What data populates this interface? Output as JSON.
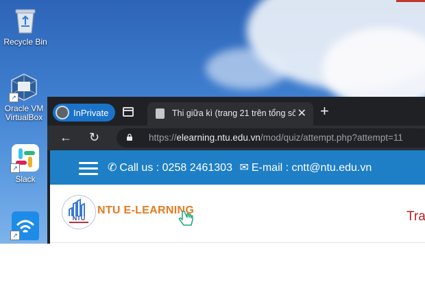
{
  "desktop": {
    "icons": [
      {
        "label": "Recycle Bin",
        "icon": "recycle-bin-icon"
      },
      {
        "label": "Oracle VM VirtualBox",
        "icon": "virtualbox-icon"
      },
      {
        "label": "Slack",
        "icon": "slack-icon"
      },
      {
        "label": "",
        "icon": "wifi-app-icon"
      }
    ]
  },
  "browser": {
    "inprivate_label": "InPrivate",
    "tab_title": "Thi giữa kì (trang 21 trên tổng số",
    "url_scheme": "https://",
    "url_host": "elearning.ntu.edu.vn",
    "url_path": "/mod/quiz/attempt.php?attempt=11",
    "new_tab_symbol": "+"
  },
  "site": {
    "phone_text": "Call us : 0258 2461303",
    "email_text": "E-mail : cntt@ntu.edu.vn",
    "logo_text": "NTU E-LEARNING",
    "logo_abbr": "NTU",
    "right_text": "Tra",
    "colors": {
      "topbar": "#1e7fc6",
      "logo_orange": "#e8791e",
      "right_text": "#b22222"
    }
  }
}
